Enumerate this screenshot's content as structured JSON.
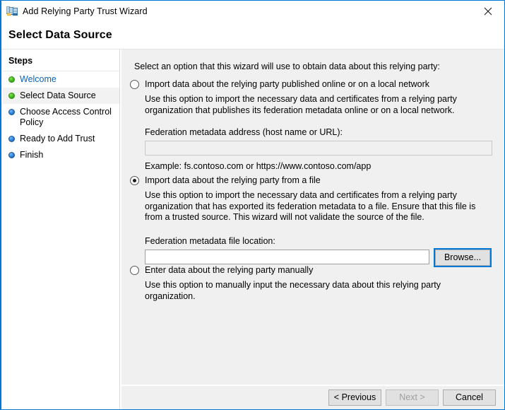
{
  "window": {
    "title": "Add Relying Party Trust Wizard",
    "title_icon": "adfs-wizard-icon",
    "close_icon": "close-icon",
    "accent_color": "#0078d7",
    "content_bg": "#f0f0f0"
  },
  "page": {
    "heading": "Select Data Source"
  },
  "sidebar": {
    "title": "Steps",
    "items": [
      {
        "label": "Welcome",
        "state": "done",
        "bullet_color": "#3fb519",
        "link": true
      },
      {
        "label": "Select Data Source",
        "state": "current",
        "bullet_color": "#3fb519",
        "link": false
      },
      {
        "label": "Choose Access Control Policy",
        "state": "pending",
        "bullet_color": "#2a7fd4",
        "link": false
      },
      {
        "label": "Ready to Add Trust",
        "state": "pending",
        "bullet_color": "#2a7fd4",
        "link": false
      },
      {
        "label": "Finish",
        "state": "pending",
        "bullet_color": "#2a7fd4",
        "link": false
      }
    ]
  },
  "main": {
    "intro": "Select an option that this wizard will use to obtain data about this relying party:",
    "options": [
      {
        "label": "Import data about the relying party published online or on a local network",
        "selected": false,
        "description": "Use this option to import the necessary data and certificates from a relying party organization that publishes its federation metadata online or on a local network.",
        "field_label": "Federation metadata address (host name or URL):",
        "field_value": "",
        "field_disabled": true,
        "example": "Example: fs.contoso.com or https://www.contoso.com/app"
      },
      {
        "label": "Import data about the relying party from a file",
        "selected": true,
        "description": "Use this option to import the necessary data and certificates from a relying party organization that has exported its federation metadata to a file. Ensure that this file is from a trusted source.  This wizard will not validate the source of the file.",
        "field_label": "Federation metadata file location:",
        "field_value": "",
        "field_disabled": false,
        "browse_label": "Browse..."
      },
      {
        "label": "Enter data about the relying party manually",
        "selected": false,
        "description": "Use this option to manually input the necessary data about this relying party organization."
      }
    ]
  },
  "footer": {
    "previous_label": "< Previous",
    "next_label": "Next >",
    "next_disabled": true,
    "cancel_label": "Cancel"
  }
}
